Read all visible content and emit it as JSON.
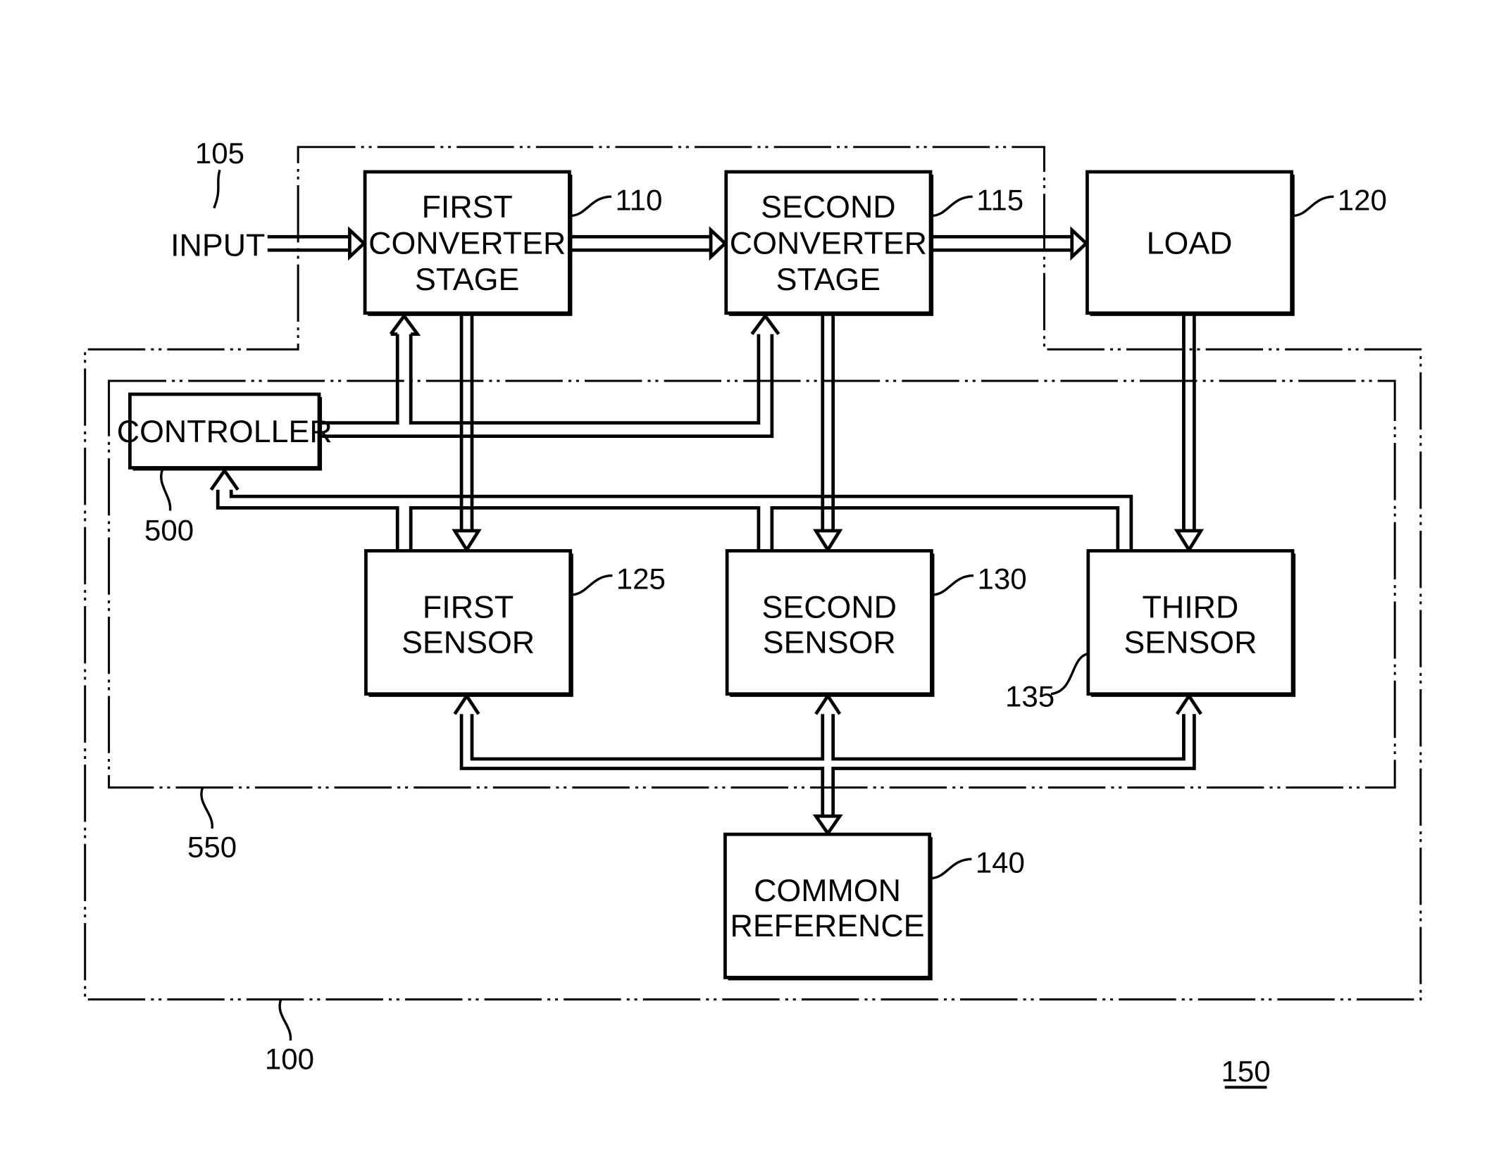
{
  "figure": {
    "ref_number": "150",
    "system_ref": "100",
    "sensing_group_ref": "550"
  },
  "blocks": {
    "input": {
      "label": "INPUT",
      "ref": "105"
    },
    "first_converter": {
      "lines": [
        "FIRST",
        "CONVERTER",
        "STAGE"
      ],
      "ref": "110"
    },
    "second_converter": {
      "lines": [
        "SECOND",
        "CONVERTER",
        "STAGE"
      ],
      "ref": "115"
    },
    "load": {
      "lines": [
        "LOAD"
      ],
      "ref": "120"
    },
    "controller": {
      "lines": [
        "CONTROLLER"
      ],
      "ref": "500"
    },
    "first_sensor": {
      "lines": [
        "FIRST",
        "SENSOR"
      ],
      "ref": "125"
    },
    "second_sensor": {
      "lines": [
        "SECOND",
        "SENSOR"
      ],
      "ref": "130"
    },
    "third_sensor": {
      "lines": [
        "THIRD",
        "SENSOR"
      ],
      "ref": "135"
    },
    "common_reference": {
      "lines": [
        "COMMON",
        "REFERENCE"
      ],
      "ref": "140"
    }
  },
  "connections": [
    {
      "from": "input",
      "to": "first_converter"
    },
    {
      "from": "first_converter",
      "to": "second_converter"
    },
    {
      "from": "second_converter",
      "to": "load"
    },
    {
      "from": "first_converter",
      "to": "first_sensor"
    },
    {
      "from": "second_converter",
      "to": "second_sensor"
    },
    {
      "from": "load",
      "to": "third_sensor"
    },
    {
      "from": "controller",
      "to": "first_converter"
    },
    {
      "from": "controller",
      "to": "second_converter"
    },
    {
      "from": "first_sensor",
      "to": "controller"
    },
    {
      "from": "second_sensor",
      "to": "controller"
    },
    {
      "from": "third_sensor",
      "to": "controller"
    },
    {
      "from": "common_reference",
      "to": "first_sensor",
      "bidirectional": true
    },
    {
      "from": "common_reference",
      "to": "second_sensor",
      "bidirectional": true
    },
    {
      "from": "common_reference",
      "to": "third_sensor",
      "bidirectional": true
    }
  ]
}
